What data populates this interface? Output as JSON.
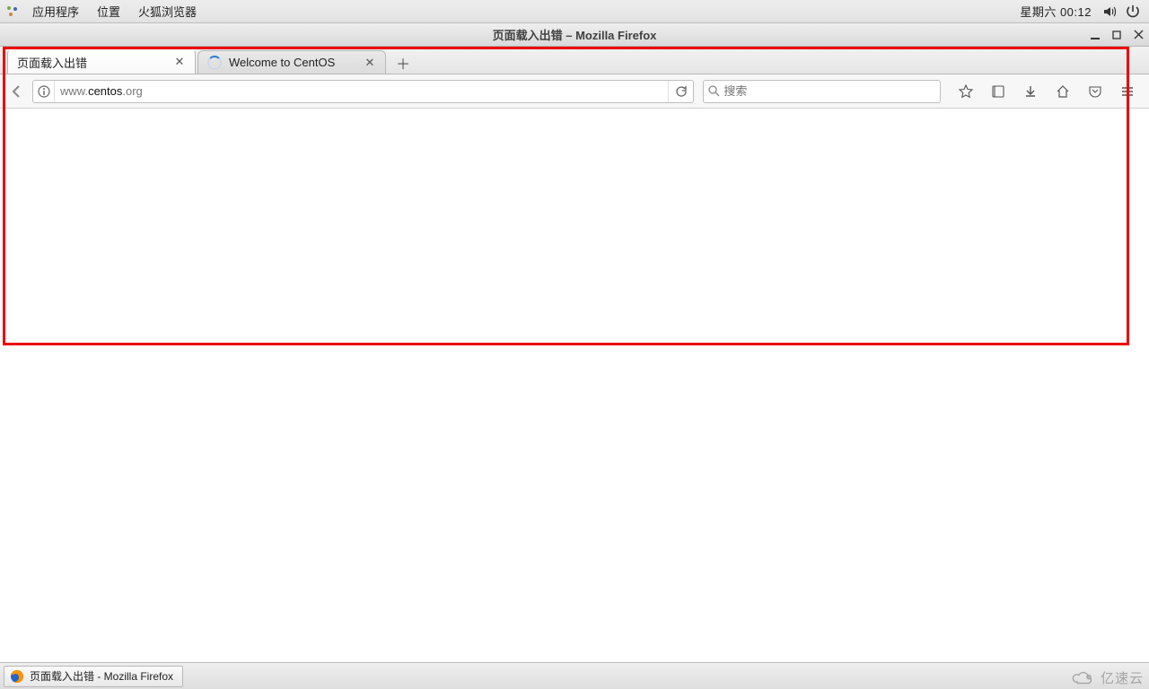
{
  "top_panel": {
    "menus": {
      "apps": "应用程序",
      "places": "位置",
      "firefox": "火狐浏览器"
    },
    "clock": "星期六 00:12"
  },
  "window": {
    "title": "页面载入出错  –  Mozilla Firefox"
  },
  "tabs": {
    "active": {
      "title": "页面载入出错"
    },
    "loading": {
      "title": "Welcome to CentOS"
    }
  },
  "urlbar": {
    "prefix": "www.",
    "host": "centos",
    "suffix": ".org",
    "value": "www.centos.org"
  },
  "searchbar": {
    "placeholder": "搜索"
  },
  "taskbar": {
    "task": "页面载入出错 - Mozilla Firefox"
  },
  "watermark": {
    "text": "亿速云"
  }
}
